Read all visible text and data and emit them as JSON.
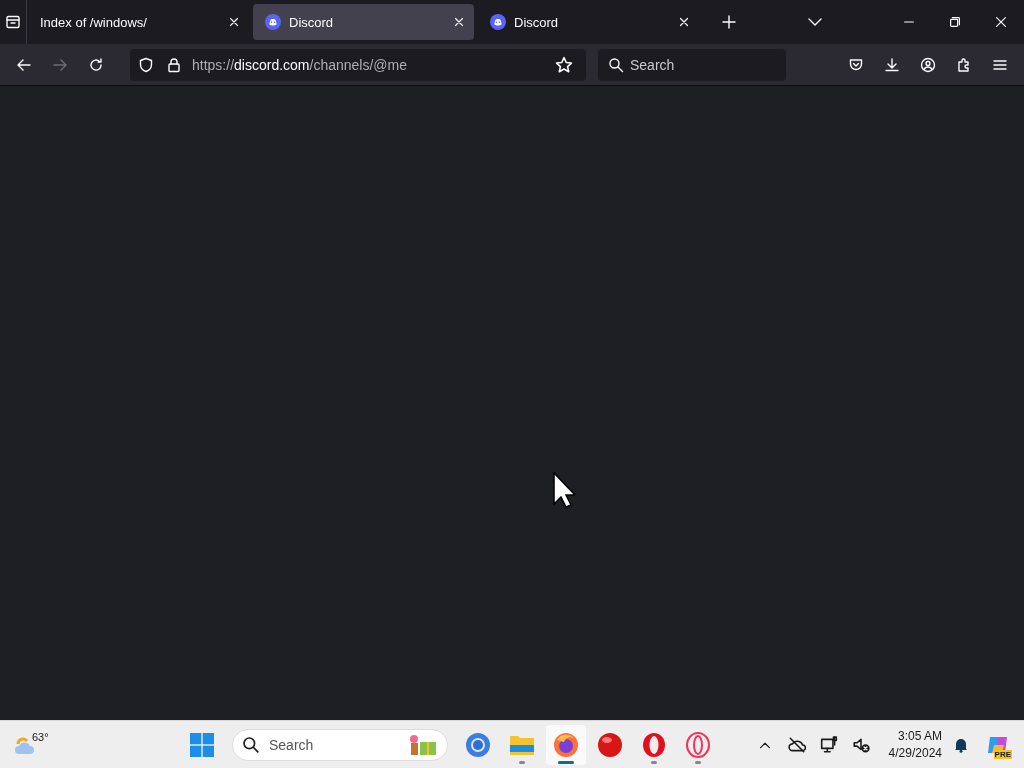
{
  "tabs": [
    {
      "title": "Index of /windows/",
      "selected": false,
      "kind": "plain"
    },
    {
      "title": "Discord",
      "selected": true,
      "kind": "discord"
    },
    {
      "title": "Discord",
      "selected": false,
      "kind": "discord"
    }
  ],
  "address_bar": {
    "prefix": "https://",
    "domain": "discord.com",
    "path": "/channels/@me"
  },
  "search_field": {
    "placeholder": "Search"
  },
  "taskbar": {
    "weather": {
      "temperature": "63°"
    },
    "search": {
      "placeholder": "Search"
    },
    "apps": [
      {
        "kind": "chrome",
        "running": false,
        "selected": false
      },
      {
        "kind": "files",
        "running": true,
        "selected": false
      },
      {
        "kind": "firefox",
        "running": true,
        "selected": true
      },
      {
        "kind": "redball",
        "running": false,
        "selected": false
      },
      {
        "kind": "opera",
        "running": true,
        "selected": false
      },
      {
        "kind": "operagx",
        "running": true,
        "selected": false
      }
    ],
    "clock": {
      "time": "3:05 AM",
      "date": "4/29/2024"
    },
    "copilot_badge": "PRE"
  }
}
